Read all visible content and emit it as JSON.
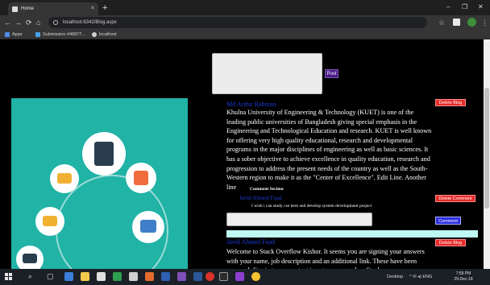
{
  "browser": {
    "tab_title": "Home",
    "tab_close": "×",
    "new_tab": "+",
    "window_controls": {
      "minimize": "–",
      "maximize": "❐",
      "close": "✕"
    },
    "nav": {
      "back": "←",
      "forward": "→",
      "reload": "⟳",
      "home": "⌂"
    },
    "address": "localhost:6342/Blog.aspx",
    "star": "☆",
    "menu": "⋮",
    "bookmarks": [
      {
        "label": "Apps",
        "color": "#4f8de8"
      },
      {
        "label": "Submission #46877...",
        "color": "#4aa0e6"
      },
      {
        "label": "localhost",
        "color": "#d0d0d0"
      }
    ]
  },
  "composer": {
    "post_label": "Post"
  },
  "posts": [
    {
      "author": "Md Arifur Rahman",
      "delete_label": "Delete Blog",
      "text": "Khulna University of Engineering & Technology (KUET) is one of the leading public universities of Bangladesh giving special emphasis in the Engineering and Technological Education and research. KUET is well known for offering very high quality educational, research and developmental programs in the major disciplines of engineering as well as basic sciences. It has a sober objective to achieve excellence in quality education, research and progression to address the present needs of the country as well as the South-Western region to make it as the \"Center of Excellence\". Edit Line. Another line"
    }
  ],
  "comments": {
    "section_title": "Comment Section",
    "items": [
      {
        "author": "Javid Ahmed Fuad",
        "delete_label": "Delete Comment",
        "text": "I wish i can study cse here and develop system development project"
      }
    ],
    "comment_button": "Comment"
  },
  "posts2": [
    {
      "author": "Javid Ahmed Fuad",
      "delete_label": "Delete Blog",
      "text": "Welcome to Stack Overflow Kishor. It seems you are signing your answers with your name, job description and an additional link. These have been removed. Signing your content is not encouraged on Stack"
    }
  ],
  "taskbar": {
    "tray_label": "Desktop",
    "tray_icons": "^ ✉ ◂) ENG",
    "time": "7:59 PM",
    "date": "29-Dec-18",
    "apps": [
      {
        "name": "search",
        "glyph": "⌕"
      },
      {
        "name": "task-view",
        "glyph": "▢"
      }
    ]
  },
  "colors": {
    "page_bg": "#000000",
    "link_blue": "#1d3bd6",
    "delete_red": "#e52a2a",
    "post_purple": "#4b1a89",
    "comment_blue": "#2a2ee0",
    "hero_teal": "#20b3a6"
  }
}
